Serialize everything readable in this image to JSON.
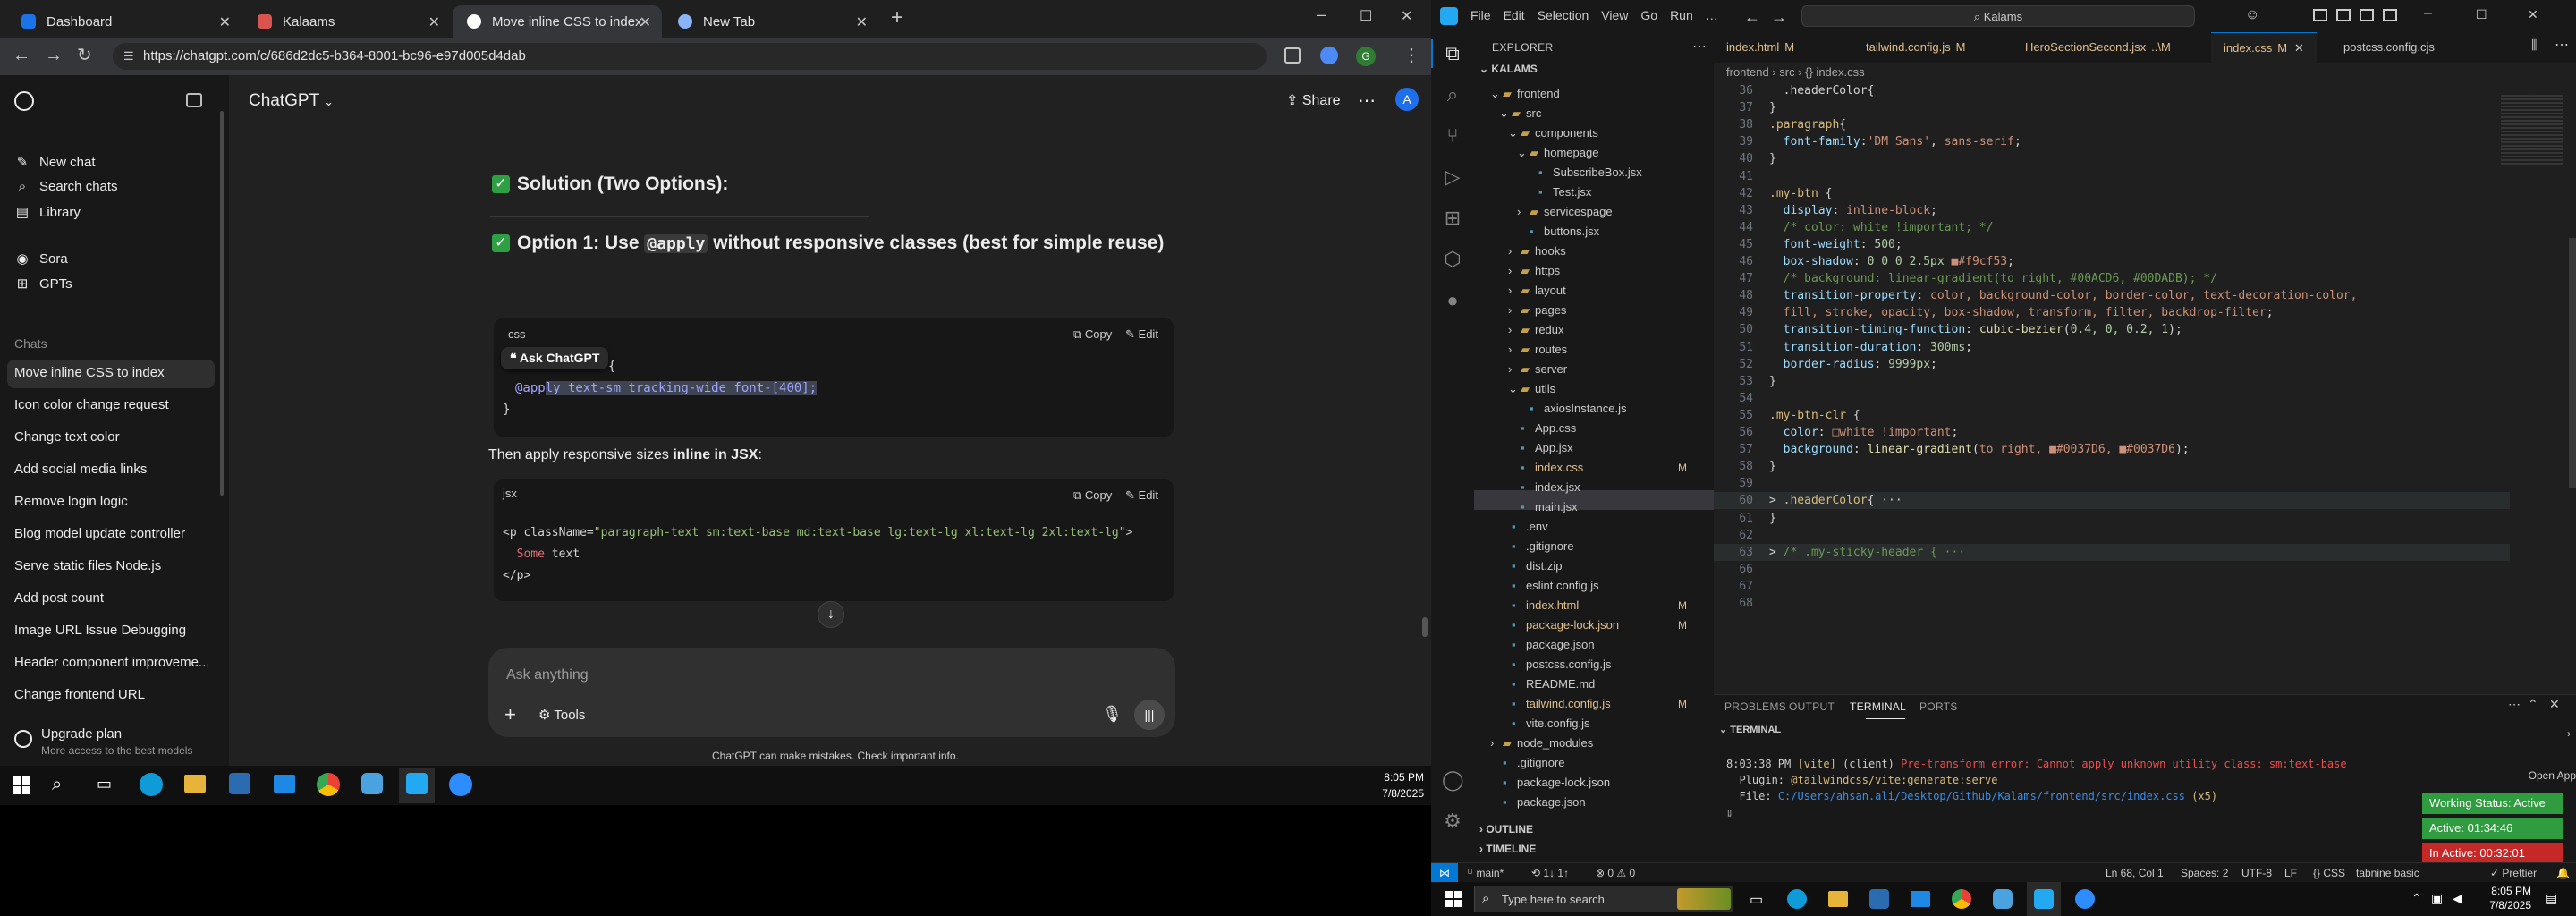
{
  "browser": {
    "tabs": [
      {
        "title": "Dashboard",
        "color": "#1a73e8"
      },
      {
        "title": "Kalaams",
        "color": "#d9534f"
      },
      {
        "title": "Move inline CSS to index",
        "color": "#ffffff"
      },
      {
        "title": "New Tab",
        "color": "#8ab4f8"
      }
    ],
    "url": "https://chatgpt.com/c/686d2dc5-b364-8001-bc96-e97d005d4dab",
    "new_tab": "+",
    "window_controls": [
      "–",
      "☐",
      "✕"
    ]
  },
  "chatgpt": {
    "sidebar": {
      "top_items": [
        {
          "label": "New chat",
          "icon": "new-chat-icon"
        },
        {
          "label": "Search chats",
          "icon": "search-icon"
        },
        {
          "label": "Library",
          "icon": "library-icon"
        },
        {
          "label": "Sora",
          "icon": "sora-icon"
        },
        {
          "label": "GPTs",
          "icon": "gpts-icon"
        }
      ],
      "chats_heading": "Chats",
      "chats": [
        "Move inline CSS to index",
        "Icon color change request",
        "Change text color",
        "Add social media links",
        "Remove login logic",
        "Blog model update controller",
        "Serve static files Node.js",
        "Add post count",
        "Image URL Issue Debugging",
        "Header component improveme...",
        "Change frontend URL"
      ],
      "upgrade_title": "Upgrade plan",
      "upgrade_sub": "More access to the best models"
    },
    "header": {
      "model": "ChatGPT",
      "share": "Share",
      "avatar": "A"
    },
    "content": {
      "solution_heading": "Solution (Two Options):",
      "option1_prefix": "Option 1: Use ",
      "option1_code": "@apply",
      "option1_suffix": " without responsive classes (best for simple reuse)",
      "code1_lang": "css",
      "copy": "Copy",
      "edit": "Edit",
      "ask_chatgpt": "Ask ChatGPT",
      "code1_brace": "{",
      "code1_apply_a": "@app",
      "code1_apply_b": "ly text-sm tracking-wide font-[400];",
      "code1_close": "}",
      "then_text_a": "Then apply responsive sizes ",
      "then_text_b": "inline in JSX",
      "then_text_c": ":",
      "code2_lang": "jsx",
      "code2_line1_a": "<p className=",
      "code2_line1_b": "\"paragraph-text sm:text-base md:text-base lg:text-lg xl:text-lg 2xl:text-lg\"",
      "code2_line1_c": ">",
      "code2_line2_a": "  Some",
      "code2_line2_b": " text",
      "code2_line3": "</p>"
    },
    "composer": {
      "placeholder": "Ask anything",
      "tools": "Tools"
    },
    "disclaimer": "ChatGPT can make mistakes. Check important info."
  },
  "taskbar_left": {
    "time": "8:05 PM",
    "date": "7/8/2025"
  },
  "vscode": {
    "title_search": "Kalams",
    "menu": [
      "File",
      "Edit",
      "Selection",
      "View",
      "Go",
      "Run",
      "…"
    ],
    "explorer_title": "EXPLORER",
    "root": "KALAMS",
    "tree": [
      {
        "label": "frontend",
        "depth": 1,
        "type": "folder-open"
      },
      {
        "label": "src",
        "depth": 2,
        "type": "folder-open"
      },
      {
        "label": "components",
        "depth": 3,
        "type": "folder-open"
      },
      {
        "label": "homepage",
        "depth": 4,
        "type": "folder-open"
      },
      {
        "label": "SubscribeBox.jsx",
        "depth": 5,
        "type": "file"
      },
      {
        "label": "Test.jsx",
        "depth": 5,
        "type": "file"
      },
      {
        "label": "servicespage",
        "depth": 4,
        "type": "folder"
      },
      {
        "label": "buttons.jsx",
        "depth": 4,
        "type": "file"
      },
      {
        "label": "hooks",
        "depth": 3,
        "type": "folder"
      },
      {
        "label": "https",
        "depth": 3,
        "type": "folder"
      },
      {
        "label": "layout",
        "depth": 3,
        "type": "folder"
      },
      {
        "label": "pages",
        "depth": 3,
        "type": "folder"
      },
      {
        "label": "redux",
        "depth": 3,
        "type": "folder"
      },
      {
        "label": "routes",
        "depth": 3,
        "type": "folder"
      },
      {
        "label": "server",
        "depth": 3,
        "type": "folder"
      },
      {
        "label": "utils",
        "depth": 3,
        "type": "folder-open"
      },
      {
        "label": "axiosInstance.js",
        "depth": 4,
        "type": "file"
      },
      {
        "label": "App.css",
        "depth": 3,
        "type": "file"
      },
      {
        "label": "App.jsx",
        "depth": 3,
        "type": "file"
      },
      {
        "label": "index.css",
        "depth": 3,
        "type": "file",
        "badge": "M",
        "selected": true
      },
      {
        "label": "index.jsx",
        "depth": 3,
        "type": "file"
      },
      {
        "label": "main.jsx",
        "depth": 3,
        "type": "file"
      },
      {
        "label": ".env",
        "depth": 2,
        "type": "file"
      },
      {
        "label": ".gitignore",
        "depth": 2,
        "type": "file"
      },
      {
        "label": "dist.zip",
        "depth": 2,
        "type": "file"
      },
      {
        "label": "eslint.config.js",
        "depth": 2,
        "type": "file"
      },
      {
        "label": "index.html",
        "depth": 2,
        "type": "file",
        "badge": "M"
      },
      {
        "label": "package-lock.json",
        "depth": 2,
        "type": "file",
        "badge": "M"
      },
      {
        "label": "package.json",
        "depth": 2,
        "type": "file"
      },
      {
        "label": "postcss.config.js",
        "depth": 2,
        "type": "file"
      },
      {
        "label": "README.md",
        "depth": 2,
        "type": "file"
      },
      {
        "label": "tailwind.config.js",
        "depth": 2,
        "type": "file",
        "badge": "M"
      },
      {
        "label": "vite.config.js",
        "depth": 2,
        "type": "file"
      },
      {
        "label": "node_modules",
        "depth": 1,
        "type": "folder"
      },
      {
        "label": ".gitignore",
        "depth": 1,
        "type": "file"
      },
      {
        "label": "package-lock.json",
        "depth": 1,
        "type": "file"
      },
      {
        "label": "package.json",
        "depth": 1,
        "type": "file"
      }
    ],
    "outline": "OUTLINE",
    "timeline": "TIMELINE",
    "tabs": [
      {
        "label": "index.html",
        "badge": "M"
      },
      {
        "label": "tailwind.config.js",
        "badge": "M"
      },
      {
        "label": "HeroSectionSecond.jsx",
        "badge": "..\\M"
      },
      {
        "label": "index.css",
        "badge": "M",
        "active": true
      },
      {
        "label": "postcss.config.cjs",
        "badge": ""
      }
    ],
    "breadcrumb": "frontend  ›  src  ›  {} index.css",
    "code": [
      {
        "n": "36",
        "t": [
          [
            "w",
            "  .headerColor{"
          ]
        ]
      },
      {
        "n": "37",
        "t": [
          [
            "w",
            "}"
          ]
        ]
      },
      {
        "n": "38",
        "t": [
          [
            "k",
            ".paragraph"
          ],
          [
            "w",
            "{"
          ]
        ]
      },
      {
        "n": "39",
        "t": [
          [
            "p",
            "  font-family"
          ],
          [
            "w",
            ":"
          ],
          [
            "v",
            "'DM Sans'"
          ],
          [
            "w",
            ", "
          ],
          [
            "v",
            "sans-serif"
          ],
          [
            "w",
            ";"
          ]
        ]
      },
      {
        "n": "40",
        "t": [
          [
            "w",
            "}"
          ]
        ]
      },
      {
        "n": "41",
        "t": [
          [
            "w",
            ""
          ]
        ]
      },
      {
        "n": "42",
        "t": [
          [
            "k",
            ".my-btn"
          ],
          [
            "w",
            " {"
          ]
        ]
      },
      {
        "n": "43",
        "t": [
          [
            "p",
            "  display"
          ],
          [
            "w",
            ": "
          ],
          [
            "v",
            "inline-block"
          ],
          [
            "w",
            ";"
          ]
        ]
      },
      {
        "n": "44",
        "t": [
          [
            "c",
            "  /* color: white !important; */"
          ]
        ]
      },
      {
        "n": "45",
        "t": [
          [
            "p",
            "  font-weight"
          ],
          [
            "w",
            ": "
          ],
          [
            "n",
            "500"
          ],
          [
            "w",
            ";"
          ]
        ]
      },
      {
        "n": "46",
        "t": [
          [
            "p",
            "  box-shadow"
          ],
          [
            "w",
            ": "
          ],
          [
            "n",
            "0 0 0 2.5px "
          ],
          [
            "v",
            "■#f9cf53"
          ],
          [
            "w",
            ";"
          ]
        ]
      },
      {
        "n": "47",
        "t": [
          [
            "c",
            "  /* background: linear-gradient(to right, #00ACD6, #00DADB); */"
          ]
        ]
      },
      {
        "n": "48",
        "t": [
          [
            "p",
            "  transition-property"
          ],
          [
            "w",
            ": "
          ],
          [
            "v",
            "color, background-color, border-color, text-decoration-color,"
          ]
        ]
      },
      {
        "n": "49",
        "t": [
          [
            "v",
            "  fill, stroke, opacity, box-shadow, transform, filter, backdrop-filter"
          ],
          [
            "w",
            ";"
          ]
        ]
      },
      {
        "n": "50",
        "t": [
          [
            "p",
            "  transition-timing-function"
          ],
          [
            "w",
            ": "
          ],
          [
            "f",
            "cubic-bezier"
          ],
          [
            "w",
            "("
          ],
          [
            "n",
            "0.4, 0, 0.2, 1"
          ],
          [
            "w",
            ");"
          ]
        ]
      },
      {
        "n": "51",
        "t": [
          [
            "p",
            "  transition-duration"
          ],
          [
            "w",
            ": "
          ],
          [
            "n",
            "300ms"
          ],
          [
            "w",
            ";"
          ]
        ]
      },
      {
        "n": "52",
        "t": [
          [
            "p",
            "  border-radius"
          ],
          [
            "w",
            ": "
          ],
          [
            "n",
            "9999px"
          ],
          [
            "w",
            ";"
          ]
        ]
      },
      {
        "n": "53",
        "t": [
          [
            "w",
            "}"
          ]
        ]
      },
      {
        "n": "54",
        "t": [
          [
            "w",
            ""
          ]
        ]
      },
      {
        "n": "55",
        "t": [
          [
            "k",
            ".my-btn-clr"
          ],
          [
            "w",
            " {"
          ]
        ]
      },
      {
        "n": "56",
        "t": [
          [
            "p",
            "  color"
          ],
          [
            "w",
            ": "
          ],
          [
            "v",
            "□white !important"
          ],
          [
            "w",
            ";"
          ]
        ]
      },
      {
        "n": "57",
        "t": [
          [
            "p",
            "  background"
          ],
          [
            "w",
            ": "
          ],
          [
            "f",
            "linear-gradient"
          ],
          [
            "w",
            "("
          ],
          [
            "v",
            "to right, ■#0037D6, ■#0037D6"
          ],
          [
            "w",
            ");"
          ]
        ]
      },
      {
        "n": "58",
        "t": [
          [
            "w",
            "}"
          ]
        ]
      },
      {
        "n": "59",
        "t": [
          [
            "w",
            ""
          ]
        ]
      },
      {
        "n": "60",
        "t": [
          [
            "w",
            "> "
          ],
          [
            "k",
            ".headerColor"
          ],
          [
            "w",
            "{ ···"
          ]
        ]
      },
      {
        "n": "61",
        "t": [
          [
            "w",
            "}"
          ]
        ]
      },
      {
        "n": "62",
        "t": [
          [
            "w",
            ""
          ]
        ]
      },
      {
        "n": "63",
        "t": [
          [
            "w",
            "> "
          ],
          [
            "c",
            "/* .my-sticky-header { ···"
          ]
        ]
      },
      {
        "n": "66",
        "t": [
          [
            "w",
            ""
          ]
        ]
      },
      {
        "n": "67",
        "t": [
          [
            "w",
            ""
          ]
        ]
      },
      {
        "n": "68",
        "t": [
          [
            "w",
            ""
          ]
        ]
      }
    ],
    "panel_tabs": [
      "PROBLEMS",
      "OUTPUT",
      "TERMINAL",
      "PORTS"
    ],
    "terminal_label": "TERMINAL",
    "terminal": {
      "line1_time": "8:03:38 PM",
      "line1_tag": "[vite]",
      "line1_client": "(client)",
      "line1_msg": "Pre-transform error: Cannot apply unknown utility class: sm:text-base",
      "line2_label": "  Plugin:",
      "line2_val": "@tailwindcss/vite:generate:serve",
      "line3_label": "  File:",
      "line3_val": "C:/Users/ahsan.ali/Desktop/Github/Kalams/frontend/src/index.css",
      "line3_count": "(x5)"
    },
    "overlay": {
      "open_app": "Open App",
      "working": "Working Status: Active",
      "active": "Active: 01:34:46",
      "inactive": "In Active: 00:32:01"
    },
    "status": {
      "branch": "main*",
      "sync": "⟲ 1↓ 1↑",
      "problems": "⊗ 0 ⚠ 0",
      "position": "Ln 68, Col 1",
      "spaces": "Spaces: 2",
      "encoding": "UTF-8",
      "eol": "LF",
      "language": "{} CSS",
      "tabnine": "tabnine basic",
      "prettier": "✓ Prettier"
    }
  },
  "taskbar_right": {
    "search": "Type here to search",
    "time": "8:05 PM",
    "date": "7/8/2025"
  }
}
